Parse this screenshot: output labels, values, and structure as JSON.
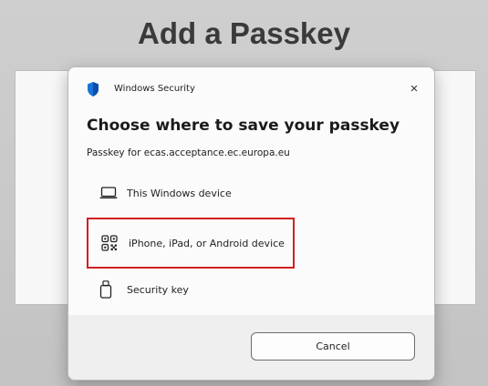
{
  "page": {
    "heading": "Add a Passkey"
  },
  "dialog": {
    "title": "Windows Security",
    "close_glyph": "×",
    "heading": "Choose where to save your passkey",
    "subtext": "Passkey for ecas.acceptance.ec.europa.eu",
    "options": [
      {
        "label": "This Windows device",
        "icon": "laptop-icon"
      },
      {
        "label": "iPhone, iPad, or Android device",
        "icon": "qr-code-icon"
      },
      {
        "label": "Security key",
        "icon": "usb-key-icon"
      }
    ],
    "cancel_label": "Cancel"
  },
  "colors": {
    "highlight": "#d21f1f",
    "shield": "#1a73d9"
  }
}
